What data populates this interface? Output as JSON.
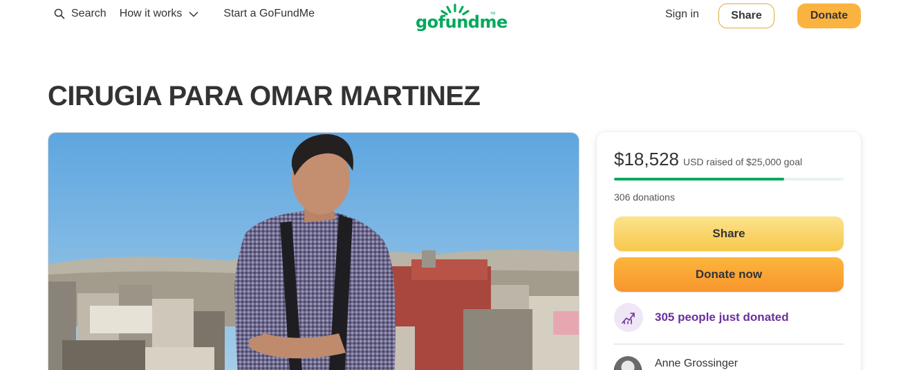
{
  "header": {
    "search_label": "Search",
    "how_it_works_label": "How it works",
    "start_label": "Start a GoFundMe",
    "logo_text": "gofundme",
    "logo_tm": "TM",
    "signin_label": "Sign in",
    "share_label": "Share",
    "donate_label": "Donate"
  },
  "campaign": {
    "title": "CIRUGIA PARA OMAR MARTINEZ"
  },
  "donation_card": {
    "raised_amount": "$18,528",
    "currency": "USD",
    "raised_suffix": "raised of $25,000 goal",
    "progress_fraction": 0.741,
    "donations_count": "306 donations",
    "share_label": "Share",
    "donate_label": "Donate now",
    "just_donated": "305 people just donated",
    "recent_donor": "Anne Grossinger"
  },
  "colors": {
    "brand_green": "#02a95c",
    "accent_yellow": "#fbb33f",
    "donate_orange": "#f8952d",
    "purple": "#6b2f9e"
  },
  "icons": [
    "search-icon",
    "chevron-down-icon",
    "sun-logo-icon",
    "trending-up-icon"
  ]
}
